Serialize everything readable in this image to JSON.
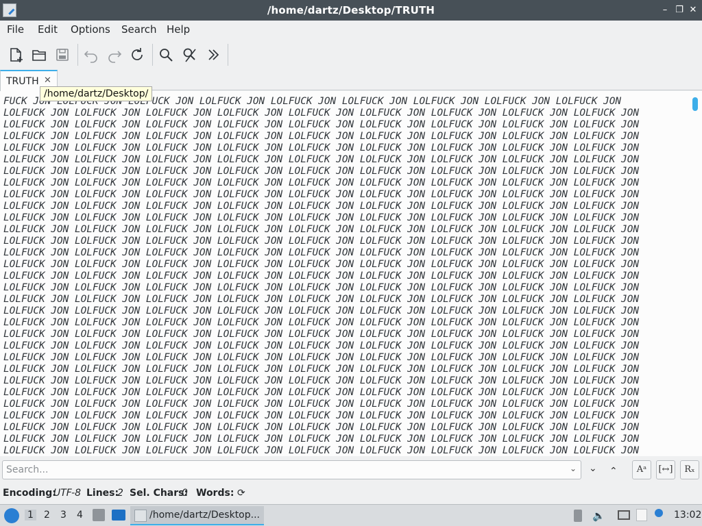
{
  "window": {
    "title": "/home/dartz/Desktop/TRUTH",
    "controls": {
      "minimize": "–",
      "maximize": "❐",
      "close": "✕"
    }
  },
  "menu": [
    "File",
    "Edit",
    "Options",
    "Search",
    "Help"
  ],
  "toolbar": {
    "icons": [
      "new-document-icon",
      "open-folder-icon",
      "save-icon",
      "undo-icon",
      "redo-icon",
      "reload-icon",
      "find-icon",
      "find-replace-icon",
      "more-icon"
    ]
  },
  "tabs": [
    {
      "label": "TRUTH",
      "close": "✕"
    }
  ],
  "tooltip": "/home/dartz/Desktop/",
  "editor": {
    "first_line": "FUCK JON LOLFUCK JON LOLFUCK JON LOLFUCK JON LOLFUCK JON LOLFUCK JON LOLFUCK JON LOLFUCK JON LOLFUCK JON",
    "repeat_line": "LOLFUCK JON LOLFUCK JON LOLFUCK JON LOLFUCK JON LOLFUCK JON LOLFUCK JON LOLFUCK JON LOLFUCK JON LOLFUCK JON",
    "visible_repeat_lines": 31
  },
  "search": {
    "placeholder": "Search...",
    "buttons": {
      "match_case": "Aᵃ",
      "whole_word": "[↔]",
      "regex": "Rₓ"
    }
  },
  "status": {
    "encoding_label": "Encoding:",
    "encoding_value": "UTF-8",
    "lines_label": "Lines:",
    "lines_value": "2",
    "selchars_label": "Sel. Chars:",
    "selchars_value": "0",
    "words_label": "Words:",
    "refresh_icon": "⟳"
  },
  "taskbar": {
    "workspaces": [
      "1",
      "2",
      "3",
      "4"
    ],
    "window_button": "/home/dartz/Desktop...",
    "clock": "13:02"
  },
  "colors": {
    "accent": "#3daee9",
    "titlebar": "#475057",
    "background": "#eff0f1"
  }
}
